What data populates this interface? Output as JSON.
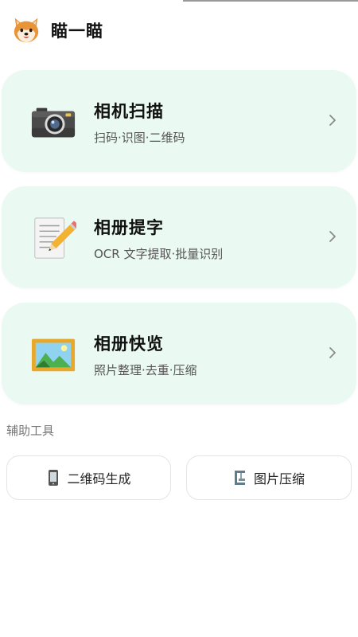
{
  "app": {
    "title": "瞄一瞄",
    "logo_icon": "shiba-dog-icon"
  },
  "cards": [
    {
      "title": "相机扫描",
      "subtitle": "扫码·识图·二维码",
      "icon": "camera-icon"
    },
    {
      "title": "相册提字",
      "subtitle": "OCR 文字提取·批量识别",
      "icon": "pencil-memo-icon"
    },
    {
      "title": "相册快览",
      "subtitle": "照片整理·去重·压缩",
      "icon": "framed-picture-icon"
    }
  ],
  "tools": {
    "section_label": "辅助工具",
    "items": [
      {
        "label": "二维码生成",
        "icon": "mobile-phone-icon"
      },
      {
        "label": "图片压缩",
        "icon": "clamp-icon"
      }
    ]
  },
  "colors": {
    "card_background": "#eaf9f2",
    "page_background": "#ffffff",
    "subtitle_text": "#555555",
    "section_label_text": "#777777"
  }
}
